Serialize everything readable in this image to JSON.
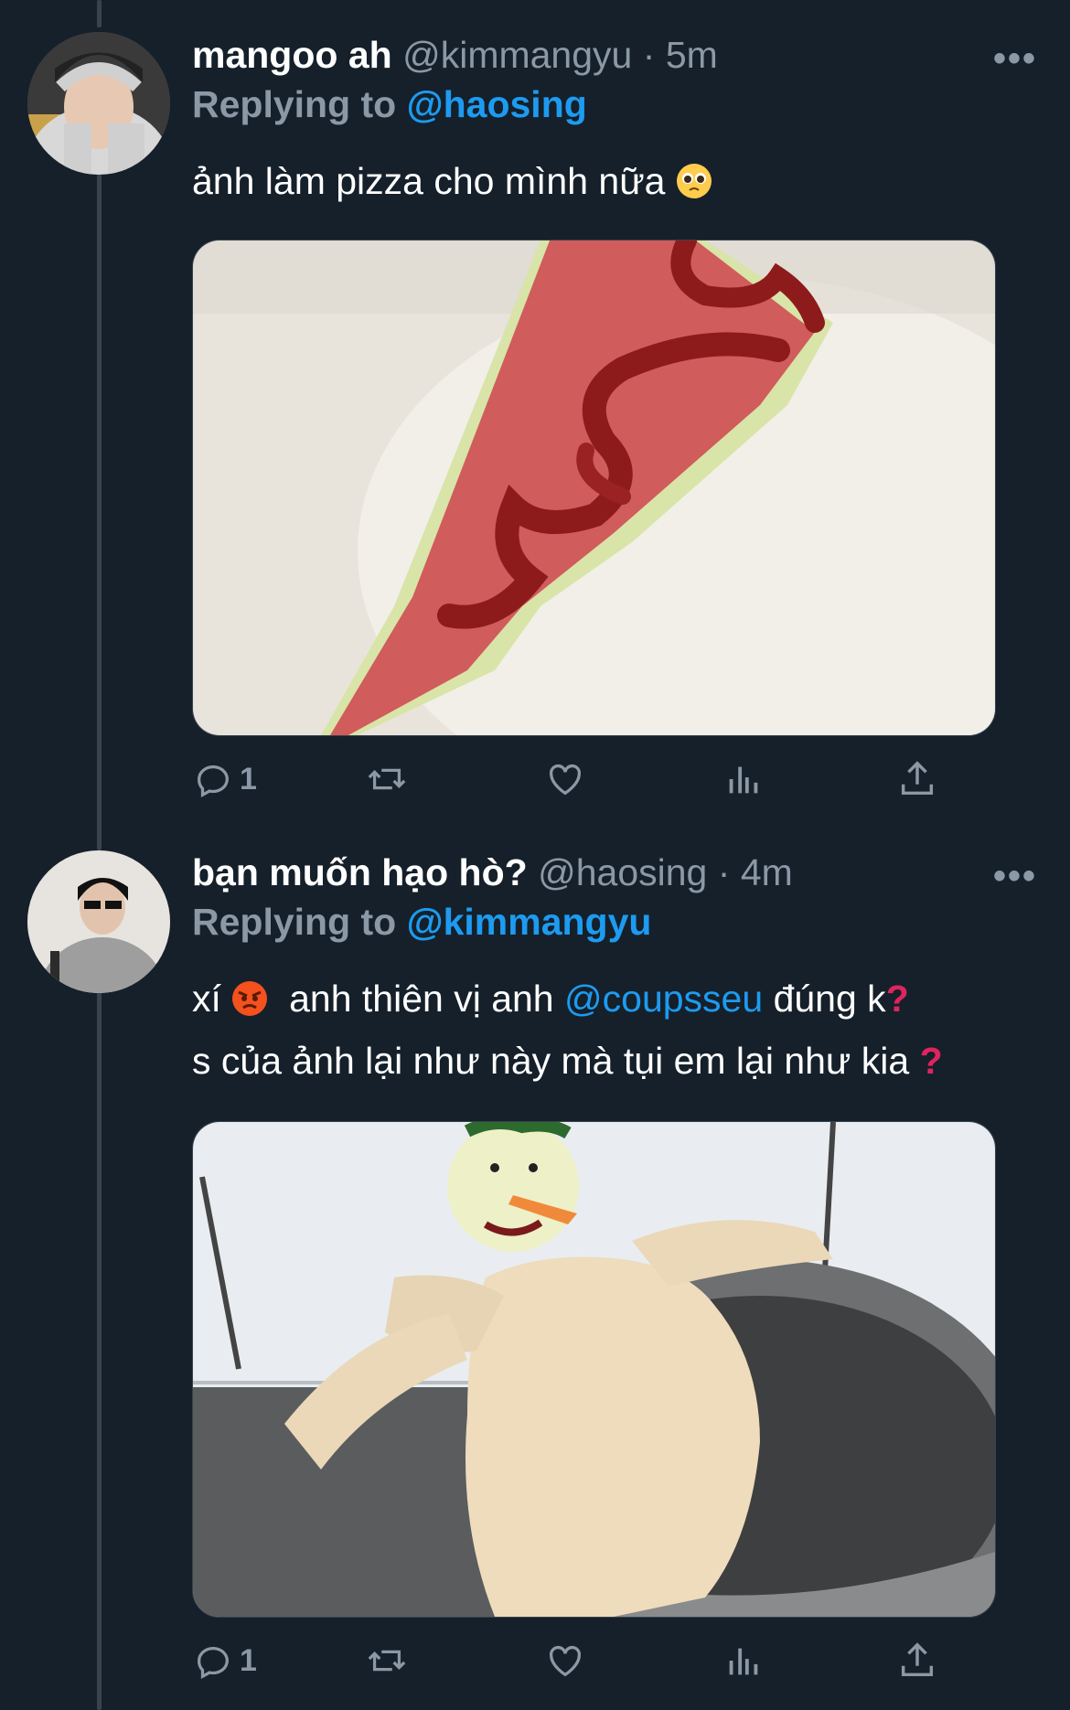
{
  "tweets": [
    {
      "display_name": "mangoo ah",
      "handle": "@kimmangyu",
      "separator": "·",
      "time": "5m",
      "replying_label": "Replying to",
      "replying_to": "@haosing",
      "text": "ảnh làm pizza cho mình nữa",
      "emoji": "pleading-face",
      "reply_count": "1"
    },
    {
      "display_name": "bạn muốn hạo hò?",
      "handle": "@haosing",
      "separator": "·",
      "time": "4m",
      "replying_label": "Replying to",
      "replying_to": "@kimmangyu",
      "text_line1_a": "xí",
      "text_line1_b": "anh thiên vị anh",
      "text_line1_mention": "@coupsseu",
      "text_line1_c": "đúng k",
      "text_line2": "s của ảnh lại như này mà tụi em lại như kia",
      "question_mark": "?",
      "emoji": "angry-face",
      "reply_count": "1"
    }
  ],
  "more_label": "•••",
  "colors": {
    "background": "#15202b",
    "secondary_text": "#8b98a5",
    "mention": "#1d9bf0",
    "thread_line": "#38444d"
  }
}
